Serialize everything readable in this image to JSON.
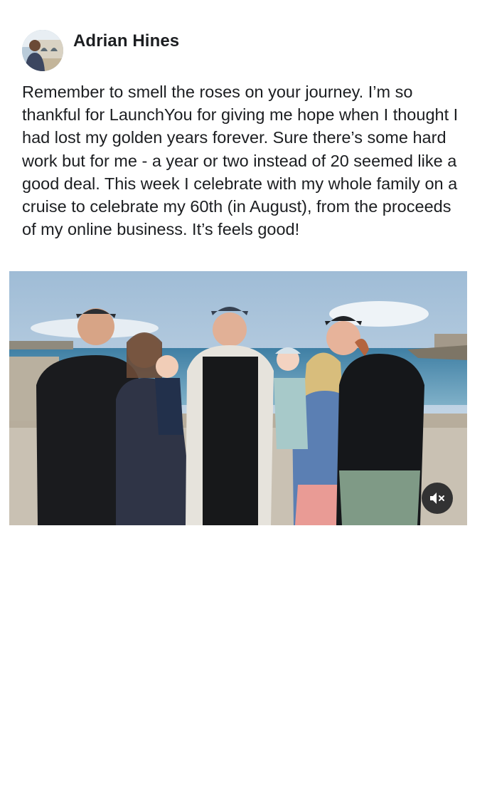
{
  "post": {
    "author": {
      "name": "Adrian Hines",
      "avatar_icon": "profile-photo"
    },
    "text": "Remember to smell the roses on your journey. I’m so thankful for LaunchYou for giving me hope when I thought I had lost my golden years forever. Sure there’s some hard work but for me - a year or two instead of 20 seemed like a good deal. This week I celebrate with my whole family on a cruise to celebrate my 60th (in August), from the proceeds of my online business. It’s feels good!",
    "media": {
      "kind": "video",
      "description_icon": "family-photo",
      "mute_icon": "speaker-muted-icon"
    }
  },
  "colors": {
    "text": "#1c1e21",
    "background": "#ffffff",
    "mute_button_bg": "#1c1e21"
  }
}
